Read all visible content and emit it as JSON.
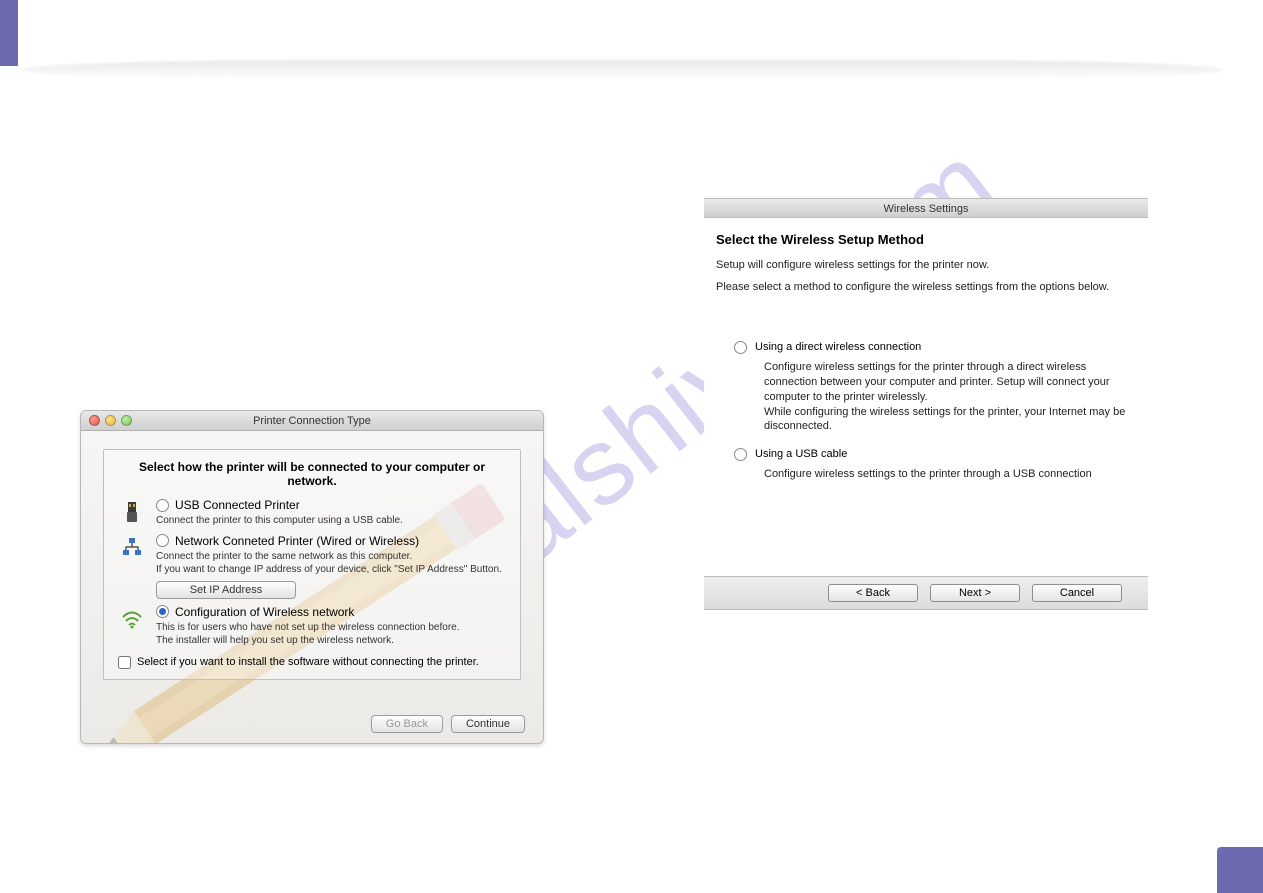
{
  "watermark": "manualshive.com",
  "left_dialog": {
    "title": "Printer Connection Type",
    "heading": "Select how the printer will be connected to your computer or network.",
    "options": [
      {
        "label": "USB Connected Printer",
        "desc": "Connect the printer to this computer using a USB cable.",
        "selected": false
      },
      {
        "label": "Network Conneted Printer (Wired or Wireless)",
        "desc": "Connect the printer to the same network as this computer.\nIf you want to change IP address of your device, click \"Set IP Address\" Button.",
        "selected": false,
        "button": "Set IP Address"
      },
      {
        "label": "Configuration of Wireless network",
        "desc": "This is for users who have not set up the wireless connection before.\nThe installer will help you set up the wireless network.",
        "selected": true
      }
    ],
    "checkbox_label": "Select if you want to install the software without connecting the printer.",
    "checkbox_checked": false,
    "buttons": {
      "back": "Go Back",
      "next": "Continue"
    }
  },
  "right_dialog": {
    "title": "Wireless Settings",
    "heading": "Select the Wireless Setup Method",
    "para1": "Setup will configure wireless settings for the printer now.",
    "para2": "Please select a method to configure the wireless settings from the options below.",
    "options": [
      {
        "label": "Using a direct wireless connection",
        "desc": "Configure wireless settings for the printer through a direct wireless connection between your computer and printer. Setup will connect your computer to the printer wirelessly.\nWhile configuring the wireless settings for the printer, your Internet may be disconnected.",
        "selected": false
      },
      {
        "label": "Using a USB cable",
        "desc": "Configure wireless settings to the printer through a USB connection",
        "selected": false
      }
    ],
    "buttons": {
      "back": "< Back",
      "next": "Next >",
      "cancel": "Cancel"
    }
  }
}
